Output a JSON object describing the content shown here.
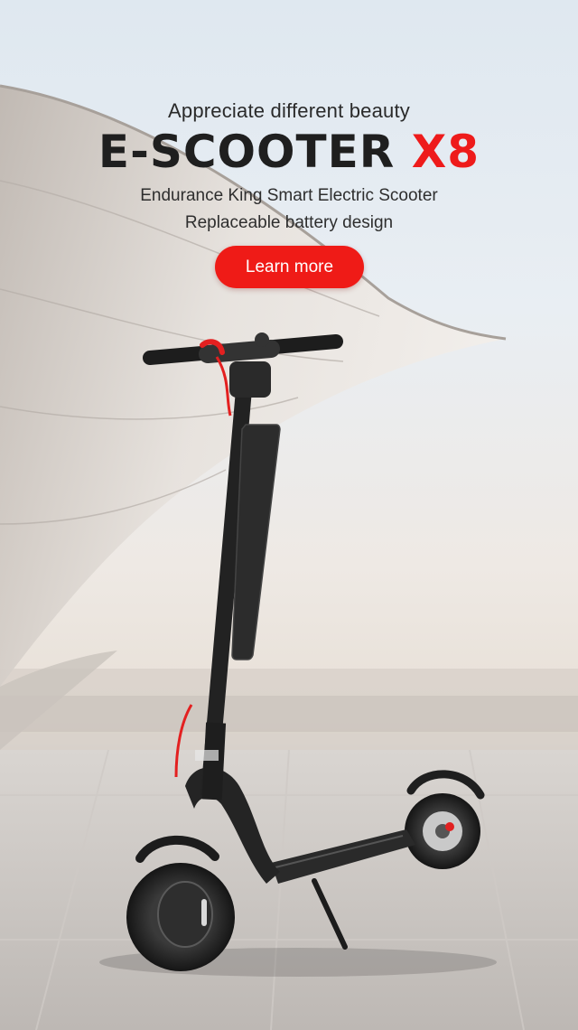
{
  "hero": {
    "tagline": "Appreciate different beauty",
    "title_main": "E-SCOOTER",
    "title_model": "X8",
    "subtitle_line1": "Endurance King Smart Electric Scooter",
    "subtitle_line2": "Replaceable battery design",
    "cta_label": "Learn more"
  },
  "colors": {
    "accent": "#ef1b17",
    "title_text": "#1f1f1f"
  }
}
